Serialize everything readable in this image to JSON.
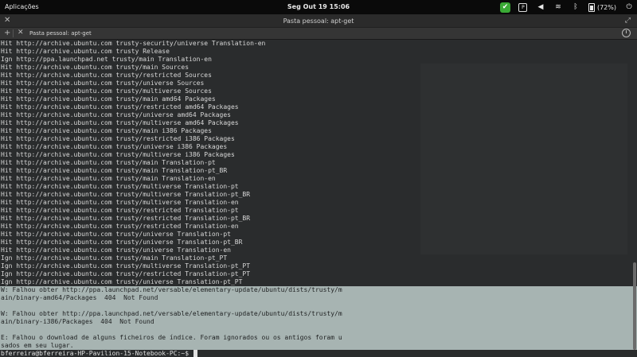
{
  "panel": {
    "apps_label": "Aplicações",
    "clock": "Seg Out 19   15:06",
    "battery": "(72%)"
  },
  "window": {
    "title": "Pasta pessoal: apt-get"
  },
  "tab": {
    "label": "Pasta pessoal: apt-get"
  },
  "terminal": {
    "lines": [
      "Hit http://archive.ubuntu.com trusty-security/universe Translation-en",
      "Hit http://archive.ubuntu.com trusty Release",
      "Ign http://ppa.launchpad.net trusty/main Translation-en",
      "Hit http://archive.ubuntu.com trusty/main Sources",
      "Hit http://archive.ubuntu.com trusty/restricted Sources",
      "Hit http://archive.ubuntu.com trusty/universe Sources",
      "Hit http://archive.ubuntu.com trusty/multiverse Sources",
      "Hit http://archive.ubuntu.com trusty/main amd64 Packages",
      "Hit http://archive.ubuntu.com trusty/restricted amd64 Packages",
      "Hit http://archive.ubuntu.com trusty/universe amd64 Packages",
      "Hit http://archive.ubuntu.com trusty/multiverse amd64 Packages",
      "Hit http://archive.ubuntu.com trusty/main i386 Packages",
      "Hit http://archive.ubuntu.com trusty/restricted i386 Packages",
      "Hit http://archive.ubuntu.com trusty/universe i386 Packages",
      "Hit http://archive.ubuntu.com trusty/multiverse i386 Packages",
      "Hit http://archive.ubuntu.com trusty/main Translation-pt",
      "Hit http://archive.ubuntu.com trusty/main Translation-pt_BR",
      "Hit http://archive.ubuntu.com trusty/main Translation-en",
      "Hit http://archive.ubuntu.com trusty/multiverse Translation-pt",
      "Hit http://archive.ubuntu.com trusty/multiverse Translation-pt_BR",
      "Hit http://archive.ubuntu.com trusty/multiverse Translation-en",
      "Hit http://archive.ubuntu.com trusty/restricted Translation-pt",
      "Hit http://archive.ubuntu.com trusty/restricted Translation-pt_BR",
      "Hit http://archive.ubuntu.com trusty/restricted Translation-en",
      "Hit http://archive.ubuntu.com trusty/universe Translation-pt",
      "Hit http://archive.ubuntu.com trusty/universe Translation-pt_BR",
      "Hit http://archive.ubuntu.com trusty/universe Translation-en",
      "Ign http://archive.ubuntu.com trusty/main Translation-pt_PT",
      "Ign http://archive.ubuntu.com trusty/multiverse Translation-pt_PT",
      "Ign http://archive.ubuntu.com trusty/restricted Translation-pt_PT",
      "Ign http://archive.ubuntu.com trusty/universe Translation-pt_PT"
    ],
    "highlighted": [
      "W: Falhou obter http://ppa.launchpad.net/versable/elementary-update/ubuntu/dists/trusty/m",
      "ain/binary-amd64/Packages  404  Not Found",
      "",
      "W: Falhou obter http://ppa.launchpad.net/versable/elementary-update/ubuntu/dists/trusty/m",
      "ain/binary-i386/Packages  404  Not Found",
      "",
      "E: Falhou o download de alguns ficheiros de índice. Foram ignorados ou os antigos foram u",
      "sados em seu lugar."
    ],
    "prompt": "bferreira@bferreira-HP-Pavilion-15-Notebook-PC:~$ "
  },
  "colors": {
    "terminal_bg": "#2a2c2d",
    "highlight_bg": "#a7b4b2",
    "panel_bg": "#0a0a0a",
    "accent_green": "#3aaa35"
  }
}
